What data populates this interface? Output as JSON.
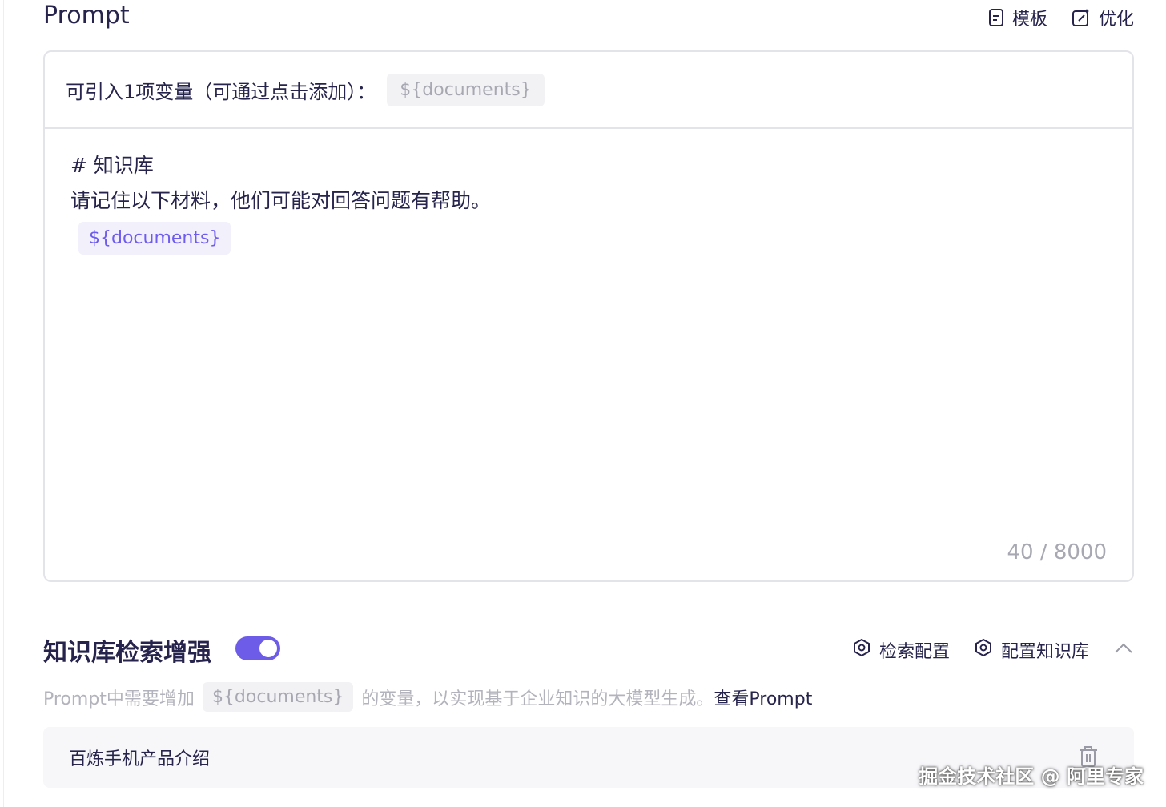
{
  "header": {
    "title": "Prompt",
    "template_label": "模板",
    "optimize_label": "优化"
  },
  "prompt_box": {
    "variables_label": "可引入1项变量（可通过点击添加）：",
    "variable_chip": "${documents}",
    "line1": "# 知识库",
    "line2": "请记住以下材料，他们可能对回答问题有帮助。",
    "inserted_variable": "${documents}",
    "char_count": "40 / 8000"
  },
  "kb": {
    "title": "知识库检索增强",
    "toggle_on": true,
    "retrieval_config_label": "检索配置",
    "configure_kb_label": "配置知识库",
    "desc_prefix": "Prompt中需要增加",
    "desc_chip": "${documents}",
    "desc_suffix": "的变量，以实现基于企业知识的大模型生成。",
    "view_prompt_link": "查看Prompt",
    "items": [
      {
        "name": "百炼手机产品介绍"
      }
    ]
  },
  "watermark": "掘金技术社区 @ 阿里专家",
  "colors": {
    "accent": "#6c5ce7",
    "text": "#26244c",
    "muted": "#a8a8b3",
    "border": "#e3e3ea"
  }
}
